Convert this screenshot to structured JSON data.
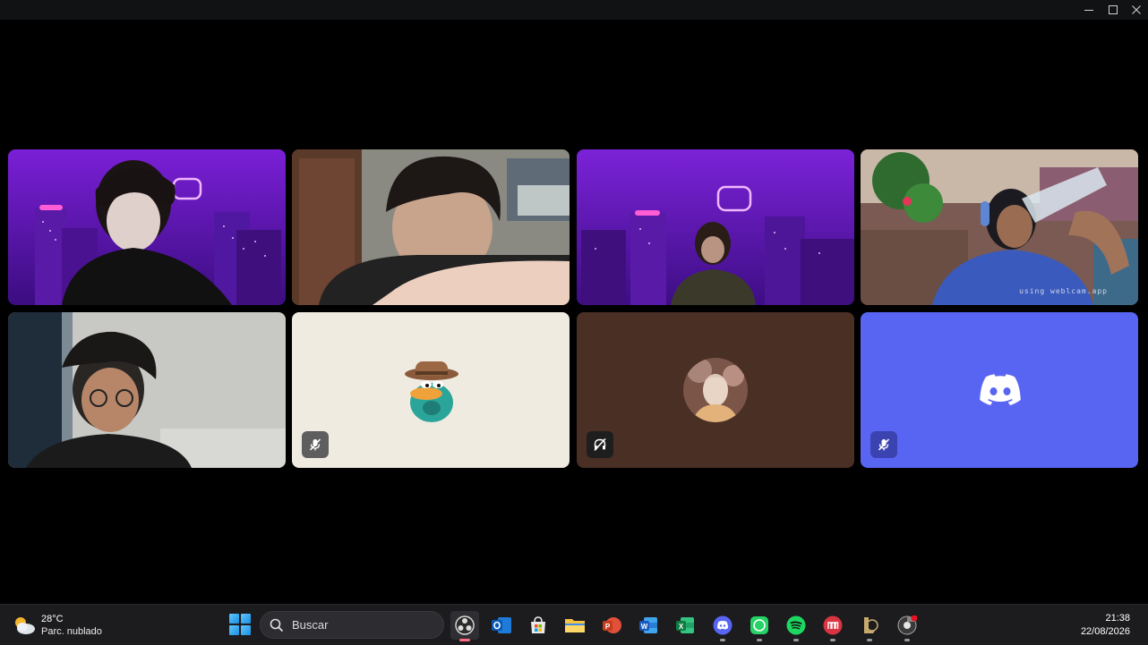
{
  "window": {
    "controls": [
      "minimize-icon",
      "maximize-icon",
      "close-icon"
    ]
  },
  "call_grid": {
    "tiles": [
      {
        "kind": "camera",
        "background": "purple-city"
      },
      {
        "kind": "camera",
        "background": "room"
      },
      {
        "kind": "camera",
        "background": "purple-city"
      },
      {
        "kind": "camera",
        "background": "game-scene",
        "overlay_text": "using weblcam.app"
      },
      {
        "kind": "camera",
        "background": "bedroom"
      },
      {
        "kind": "avatar",
        "avatar": "platypus-agent-avatar",
        "tile_color": "#efebe1",
        "status": "muted-mic-icon",
        "badge_color": "#5e5e5e"
      },
      {
        "kind": "avatar",
        "avatar": "photo-avatar",
        "tile_color": "#4a2f25",
        "status": "deafened-icon",
        "badge_color": "#1e1e1e"
      },
      {
        "kind": "avatar",
        "avatar": "discord-logo",
        "tile_color": "#5865f2",
        "status": "muted-mic-icon",
        "badge_color": "#3b43b0"
      }
    ]
  },
  "taskbar": {
    "weather": {
      "temp": "28°C",
      "desc": "Parc. nublado",
      "icon": "partly-cloudy-icon"
    },
    "search": {
      "placeholder": "Buscar"
    },
    "apps": [
      {
        "name": "obs-icon",
        "active": true
      },
      {
        "name": "outlook-icon"
      },
      {
        "name": "microsoft-store-icon"
      },
      {
        "name": "file-explorer-icon"
      },
      {
        "name": "powerpoint-icon"
      },
      {
        "name": "word-icon"
      },
      {
        "name": "excel-icon"
      },
      {
        "name": "discord-icon"
      },
      {
        "name": "whatsapp-icon"
      },
      {
        "name": "spotify-icon"
      },
      {
        "name": "tasks-icon"
      },
      {
        "name": "league-of-legends-icon"
      },
      {
        "name": "chrome-dev-icon",
        "notification": true
      }
    ],
    "clock": {
      "time": "21:38",
      "date": "22/08/2026"
    }
  },
  "colors": {
    "accent": "#5865f2",
    "taskbar": "#1c1c1f",
    "titlebar": "#111214"
  }
}
